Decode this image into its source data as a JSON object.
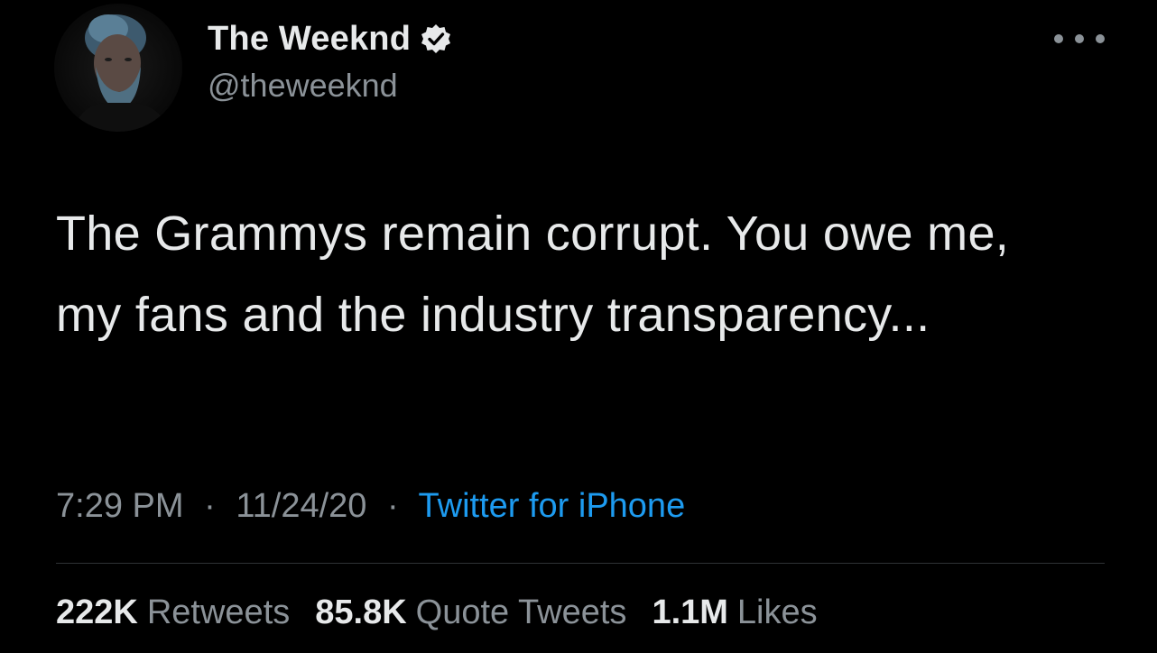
{
  "user": {
    "display_name": "The Weeknd",
    "handle": "@theweeknd",
    "verified": true
  },
  "tweet": {
    "text": "The Grammys remain corrupt. You owe me, my fans and the industry transparency...",
    "time": "7:29 PM",
    "separator": "·",
    "date": "11/24/20",
    "source": "Twitter for iPhone"
  },
  "stats": {
    "retweets_count": "222K",
    "retweets_label": "Retweets",
    "quotes_count": "85.8K",
    "quotes_label": "Quote Tweets",
    "likes_count": "1.1M",
    "likes_label": "Likes"
  },
  "colors": {
    "background": "#000000",
    "text_primary": "#e7e9ea",
    "text_secondary": "#8b9298",
    "link": "#1d9bf0"
  },
  "icons": {
    "verified": "verified-badge-icon",
    "more": "more-options-icon"
  }
}
